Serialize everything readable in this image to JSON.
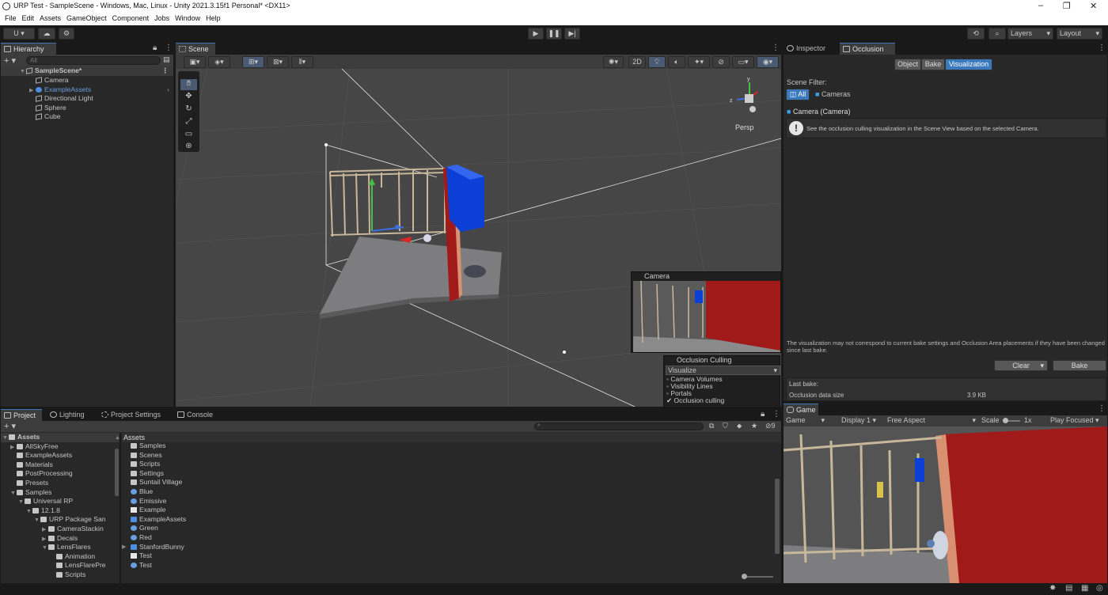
{
  "window": {
    "title": "URP Test - SampleScene - Windows, Mac, Linux - Unity 2021.3.15f1 Personal* <DX11>",
    "min": "–",
    "max": "❐",
    "close": "✕"
  },
  "menu": [
    "File",
    "Edit",
    "Assets",
    "GameObject",
    "Component",
    "Jobs",
    "Window",
    "Help"
  ],
  "toolbar": {
    "account": "U ▾",
    "layers": "Layers",
    "layout": "Layout"
  },
  "hierarchy": {
    "tab": "Hierarchy",
    "search_placeholder": "All",
    "scene": "SampleScene*",
    "items": [
      "Camera",
      "ExampleAssets",
      "Directional Light",
      "Sphere",
      "Cube"
    ]
  },
  "scene": {
    "tab": "Scene",
    "persp": "Persp",
    "toggle_2d": "2D",
    "camera_preview_title": "Camera",
    "occlusion": {
      "title": "Occlusion Culling",
      "mode": "Visualize",
      "options": [
        "Camera Volumes",
        "Visibility Lines",
        "Portals"
      ],
      "checked_option": "Occlusion culling"
    }
  },
  "inspector": {
    "tabs": [
      "Inspector",
      "Occlusion"
    ],
    "mode_buttons": [
      "Object",
      "Bake",
      "Visualization"
    ],
    "scene_filter_label": "Scene Filter:",
    "filter_all": "All",
    "filter_cameras": "Cameras",
    "camera_label": "Camera (Camera)",
    "info": "See the occlusion culling visualization in the Scene View based on the selected Camera.",
    "warning": "The visualization may not correspond to current bake settings and Occlusion Area placements if they have been changed since last bake.",
    "clear": "Clear",
    "bake": "Bake",
    "last_bake_label": "Last bake:",
    "data_size_label": "Occlusion data size",
    "data_size": "3.9 KB"
  },
  "project": {
    "tabs": [
      "Project",
      "Lighting",
      "Project Settings",
      "Console"
    ],
    "tree": [
      {
        "label": "Assets",
        "d": 0
      },
      {
        "label": "AllSkyFree",
        "d": 1
      },
      {
        "label": "ExampleAssets",
        "d": 1
      },
      {
        "label": "Materials",
        "d": 1
      },
      {
        "label": "PostProcessing",
        "d": 1
      },
      {
        "label": "Presets",
        "d": 1
      },
      {
        "label": "Samples",
        "d": 1
      },
      {
        "label": "Universal RP",
        "d": 2
      },
      {
        "label": "12.1.8",
        "d": 3
      },
      {
        "label": "URP Package San",
        "d": 4
      },
      {
        "label": "CameraStackin",
        "d": 5
      },
      {
        "label": "Decals",
        "d": 5
      },
      {
        "label": "LensFlares",
        "d": 5
      },
      {
        "label": "Animation",
        "d": 6
      },
      {
        "label": "LensFlarePre",
        "d": 6
      },
      {
        "label": "Scripts",
        "d": 6
      }
    ],
    "breadcrumb": "Assets",
    "assets": [
      {
        "label": "Samples",
        "k": "folder"
      },
      {
        "label": "Scenes",
        "k": "folder"
      },
      {
        "label": "Scripts",
        "k": "folder"
      },
      {
        "label": "Settings",
        "k": "folder"
      },
      {
        "label": "Suntail Village",
        "k": "folder"
      },
      {
        "label": "Blue",
        "k": "mat"
      },
      {
        "label": "Emissive",
        "k": "mat"
      },
      {
        "label": "Example",
        "k": "file"
      },
      {
        "label": "ExampleAssets",
        "k": "prefab"
      },
      {
        "label": "Green",
        "k": "mat"
      },
      {
        "label": "Red",
        "k": "mat"
      },
      {
        "label": "StanfordBunny",
        "k": "prefab"
      },
      {
        "label": "Test",
        "k": "file"
      },
      {
        "label": "Test",
        "k": "mat"
      }
    ],
    "hidden_count": "9"
  },
  "game": {
    "tab": "Game",
    "mode": "Game",
    "display": "Display 1",
    "aspect": "Free Aspect",
    "scale_label": "Scale",
    "scale": "1x",
    "play": "Play Focused"
  },
  "colors": {
    "accent": "#3a79bb",
    "bg": "#282828",
    "blue_box": "#0b3fd6",
    "red_wall": "#a11a1a"
  }
}
